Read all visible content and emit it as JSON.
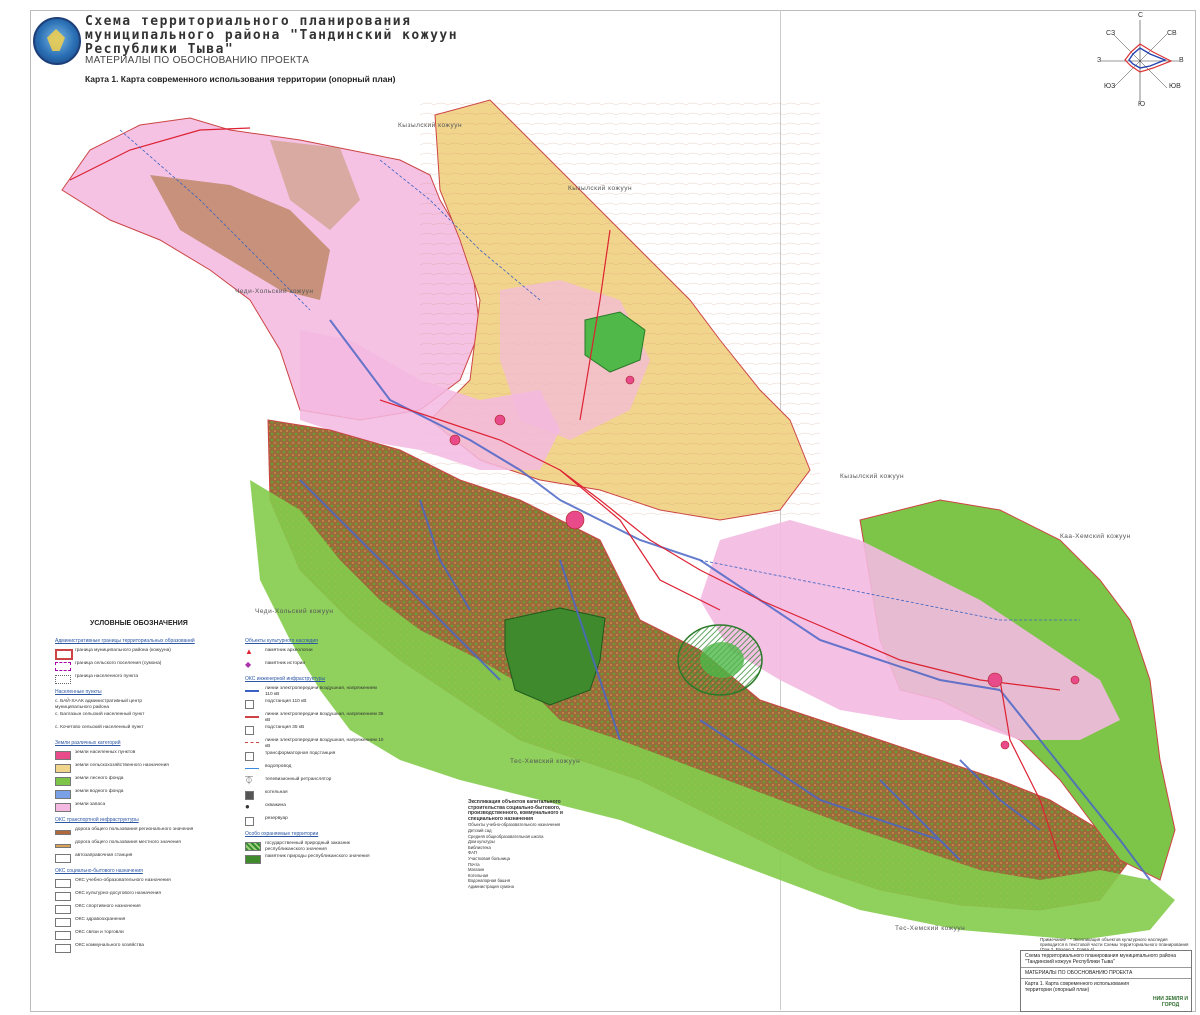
{
  "header": {
    "title_lines": [
      "Схема территориального планирования",
      "муниципального района \"Тандинский кожуун",
      "Республики Тыва\""
    ],
    "subtitle": "МАТЕРИАЛЫ ПО ОБОСНОВАНИЮ ПРОЕКТА",
    "map_title": "Карта 1. Карта современного использования территории (опорный план)"
  },
  "compass": {
    "n": "С",
    "ne": "СВ",
    "e": "В",
    "se": "ЮВ",
    "s": "Ю",
    "sw": "ЮЗ",
    "w": "З",
    "nw": "СЗ"
  },
  "neighbors": [
    {
      "name": "Кызылский кожуун"
    },
    {
      "name": "Кызылский кожуун"
    },
    {
      "name": "Чеди-Хольский кожуун"
    },
    {
      "name": "Кызылский кожуун"
    },
    {
      "name": "Каа-Хемский кожуун"
    },
    {
      "name": "Чеди-Хольский кожуун"
    },
    {
      "name": "Тес-Хемский кожуун"
    },
    {
      "name": "Тес-Хемский кожуун"
    }
  ],
  "colors": {
    "agri_land": "#f2d58c",
    "forest": "#7cc548",
    "forest_dark": "#3e8a2c",
    "mountain": "#b0693a",
    "settlement": "#e84a8a",
    "rivers": "#4b66c7",
    "pink_land": "#f3b9e0",
    "protected": "#3fa14a"
  },
  "legend": {
    "title": "УСЛОВНЫЕ ОБОЗНАЧЕНИЯ",
    "sections": [
      {
        "head": "Административные границы территориальных образований",
        "items": [
          "граница муниципального района (кожууна)",
          "граница сельского поселения (сумона)",
          "граница населенного пункта"
        ]
      },
      {
        "head": "Населенные пункты",
        "items": [
          "с. БАЙ-ХААК административный центр муниципального района",
          "с. Балгазын сельский населенный пункт",
          "с. Кочетово сельский населенный пункт"
        ]
      },
      {
        "head": "Земли различных категорий",
        "items": [
          "земли населенных пунктов",
          "земли сельскохозяйственного назначения",
          "земли лесного фонда",
          "земли водного фонда",
          "земли запаса"
        ]
      },
      {
        "head": "ОКС транспортной инфраструктуры",
        "items": [
          "дорога общего пользования регионального значения",
          "дорога общего пользования местного значения",
          "автозаправочная станция"
        ]
      },
      {
        "head": "ОКС социально-бытового назначения",
        "items": [
          "ОКС учебно-образовательного назначения",
          "ОКС культурно-досугового назначения",
          "ОКС спортивного назначения",
          "ОКС здравоохранения",
          "ОКС связи и торговли",
          "ОКС коммунального хозяйства"
        ]
      }
    ],
    "col2_head": "Объекты культурного наследия",
    "col2_items": [
      "памятник археологии",
      "памятник истории"
    ],
    "col2b_head": "ОКС инженерной инфраструктуры",
    "col2b_items": [
      "линии электропередачи воздушная, напряжением 110 кВ",
      "подстанция 110 кВ",
      "линии электропередачи воздушная, напряжением 35 кВ",
      "подстанция 35 кВ",
      "линии электропередачи воздушная, напряжением 10 кВ",
      "трансформаторная подстанция",
      "водопровод",
      "телевизионный ретранслятор",
      "котельная",
      "скважина",
      "резервуар"
    ],
    "col2c_head": "Особо охраняемые территории",
    "col2c_items": [
      "государственный природный заказник республиканского значения",
      "памятник природы республиканского значения"
    ]
  },
  "objects_list": {
    "title": "Экспликация объектов капитального строительства социально-бытового, производственного, коммунального и специального назначения",
    "items": [
      "Объекты учебно-образовательного назначения",
      "Детский сад",
      "Средняя общеобразовательная школа",
      "Дом культуры",
      "Библиотека",
      "ФАП",
      "Участковая больница",
      "Почта",
      "Магазин",
      "Котельная",
      "Водонапорная башня",
      "Администрация сумона"
    ]
  },
  "stamp": {
    "note": "Примечание - * Экспликация объектов культурного наследия приводится в текстовой части Схемы территориального планирования (Том 2, Раздел 2, Глава 4).",
    "line1": "Схема территориального планирования муниципального района \"Тандинский кожуун Республики Тыва\"",
    "line2": "МАТЕРИАЛЫ ПО ОБОСНОВАНИЮ ПРОЕКТА",
    "line3": "Карта 1. Карта современного использования территории (опорный план)",
    "org": "НИИ ЗЕМЛЯ И ГОРОД"
  }
}
